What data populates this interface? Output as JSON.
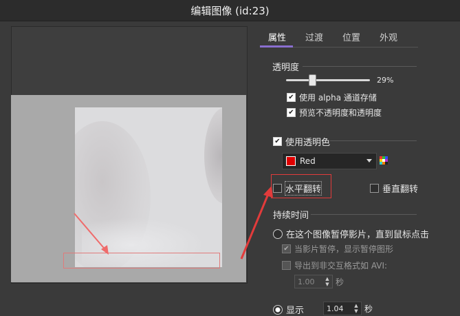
{
  "window": {
    "title": "编辑图像 (id:23)"
  },
  "tabs": [
    {
      "label": "属性",
      "active": true
    },
    {
      "label": "过渡",
      "active": false
    },
    {
      "label": "位置",
      "active": false
    },
    {
      "label": "外观",
      "active": false
    }
  ],
  "opacity": {
    "label": "透明度",
    "value_text": "29%",
    "value": 0.29,
    "use_alpha": {
      "label": "使用 alpha 通道存储",
      "checked": true
    },
    "preview_opacity": {
      "label": "预览不透明度和透明度",
      "checked": true
    }
  },
  "transparent_color": {
    "label": "使用透明色",
    "checked": true,
    "selected": "Red",
    "swatch_color": "#e00000"
  },
  "flip": {
    "horizontal": {
      "label": "水平翻转",
      "checked": false
    },
    "vertical": {
      "label": "垂直翻转",
      "checked": false
    }
  },
  "duration": {
    "label": "持续时间",
    "pause_option": {
      "label": "在这个图像暂停影片，直到鼠标点击",
      "selected": false
    },
    "show_pause": {
      "label": "当影片暂停，显示暂停图形",
      "checked": true
    },
    "export_label": "导出到非交互格式如 AVI:",
    "export_value": "1.00",
    "export_unit": "秒",
    "show_option": {
      "label": "显示",
      "selected": true
    },
    "show_value": "1.04",
    "show_unit": "秒"
  },
  "colors": {
    "accent": "#8a6fd0",
    "highlight": "#e23b3b"
  }
}
